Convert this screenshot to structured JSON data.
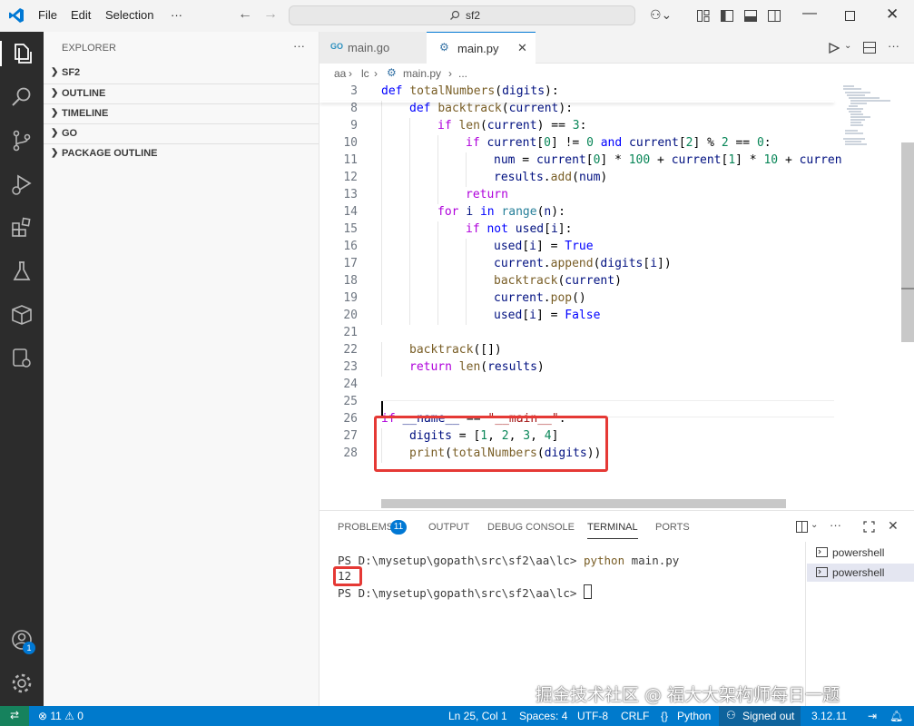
{
  "titlebar": {
    "menus": [
      "File",
      "Edit",
      "Selection",
      "···"
    ],
    "search_text": "sf2"
  },
  "sidebar": {
    "title": "EXPLORER",
    "sections": [
      "SF2",
      "OUTLINE",
      "TIMELINE",
      "GO",
      "PACKAGE OUTLINE"
    ],
    "more": "···"
  },
  "tabs": [
    {
      "label": "main.go",
      "icon_text": "GO"
    },
    {
      "label": "main.py",
      "icon_text": "⚙"
    }
  ],
  "breadcrumbs": [
    "aa",
    "lc",
    "main.py",
    "..."
  ],
  "editor": {
    "lines": [
      {
        "n": "3",
        "i": 0,
        "t": [
          [
            "kw",
            "def "
          ],
          [
            "fn",
            "totalNumbers"
          ],
          [
            "op",
            "("
          ],
          [
            "var",
            "digits"
          ],
          [
            "op",
            "):"
          ]
        ]
      },
      {
        "n": "8",
        "i": 1,
        "t": [
          [
            "kw",
            "def "
          ],
          [
            "fn",
            "backtrack"
          ],
          [
            "op",
            "("
          ],
          [
            "var",
            "current"
          ],
          [
            "op",
            "):"
          ]
        ]
      },
      {
        "n": "9",
        "i": 2,
        "t": [
          [
            "kc",
            "if "
          ],
          [
            "fn",
            "len"
          ],
          [
            "op",
            "("
          ],
          [
            "var",
            "current"
          ],
          [
            "op",
            ") == "
          ],
          [
            "num",
            "3"
          ],
          [
            "op",
            ":"
          ]
        ]
      },
      {
        "n": "10",
        "i": 3,
        "t": [
          [
            "kc",
            "if "
          ],
          [
            "var",
            "current"
          ],
          [
            "op",
            "["
          ],
          [
            "num",
            "0"
          ],
          [
            "op",
            "] != "
          ],
          [
            "num",
            "0"
          ],
          [
            "kw",
            " and "
          ],
          [
            "var",
            "current"
          ],
          [
            "op",
            "["
          ],
          [
            "num",
            "2"
          ],
          [
            "op",
            "] % "
          ],
          [
            "num",
            "2"
          ],
          [
            "op",
            " == "
          ],
          [
            "num",
            "0"
          ],
          [
            "op",
            ":"
          ]
        ]
      },
      {
        "n": "11",
        "i": 4,
        "t": [
          [
            "var",
            "num"
          ],
          [
            "op",
            " = "
          ],
          [
            "var",
            "current"
          ],
          [
            "op",
            "["
          ],
          [
            "num",
            "0"
          ],
          [
            "op",
            "] * "
          ],
          [
            "num",
            "100"
          ],
          [
            "op",
            " + "
          ],
          [
            "var",
            "current"
          ],
          [
            "op",
            "["
          ],
          [
            "num",
            "1"
          ],
          [
            "op",
            "] * "
          ],
          [
            "num",
            "10"
          ],
          [
            "op",
            " + "
          ],
          [
            "var",
            "curren"
          ]
        ]
      },
      {
        "n": "12",
        "i": 4,
        "t": [
          [
            "var",
            "results"
          ],
          [
            "op",
            "."
          ],
          [
            "fn",
            "add"
          ],
          [
            "op",
            "("
          ],
          [
            "var",
            "num"
          ],
          [
            "op",
            ")"
          ]
        ]
      },
      {
        "n": "13",
        "i": 3,
        "t": [
          [
            "kc",
            "return"
          ]
        ]
      },
      {
        "n": "14",
        "i": 2,
        "t": [
          [
            "kc",
            "for "
          ],
          [
            "var",
            "i"
          ],
          [
            "kw",
            " in "
          ],
          [
            "bi",
            "range"
          ],
          [
            "op",
            "("
          ],
          [
            "var",
            "n"
          ],
          [
            "op",
            "):"
          ]
        ]
      },
      {
        "n": "15",
        "i": 3,
        "t": [
          [
            "kc",
            "if "
          ],
          [
            "kw",
            "not "
          ],
          [
            "var",
            "used"
          ],
          [
            "op",
            "["
          ],
          [
            "var",
            "i"
          ],
          [
            "op",
            "]:"
          ]
        ]
      },
      {
        "n": "16",
        "i": 4,
        "t": [
          [
            "var",
            "used"
          ],
          [
            "op",
            "["
          ],
          [
            "var",
            "i"
          ],
          [
            "op",
            "] = "
          ],
          [
            "kw",
            "True"
          ]
        ]
      },
      {
        "n": "17",
        "i": 4,
        "t": [
          [
            "var",
            "current"
          ],
          [
            "op",
            "."
          ],
          [
            "fn",
            "append"
          ],
          [
            "op",
            "("
          ],
          [
            "var",
            "digits"
          ],
          [
            "op",
            "["
          ],
          [
            "var",
            "i"
          ],
          [
            "op",
            "])"
          ]
        ]
      },
      {
        "n": "18",
        "i": 4,
        "t": [
          [
            "fn",
            "backtrack"
          ],
          [
            "op",
            "("
          ],
          [
            "var",
            "current"
          ],
          [
            "op",
            ")"
          ]
        ]
      },
      {
        "n": "19",
        "i": 4,
        "t": [
          [
            "var",
            "current"
          ],
          [
            "op",
            "."
          ],
          [
            "fn",
            "pop"
          ],
          [
            "op",
            "()"
          ]
        ]
      },
      {
        "n": "20",
        "i": 4,
        "t": [
          [
            "var",
            "used"
          ],
          [
            "op",
            "["
          ],
          [
            "var",
            "i"
          ],
          [
            "op",
            "] = "
          ],
          [
            "kw",
            "False"
          ]
        ]
      },
      {
        "n": "21",
        "i": 0,
        "t": []
      },
      {
        "n": "22",
        "i": 1,
        "t": [
          [
            "fn",
            "backtrack"
          ],
          [
            "op",
            "([])"
          ]
        ]
      },
      {
        "n": "23",
        "i": 1,
        "t": [
          [
            "kc",
            "return "
          ],
          [
            "fn",
            "len"
          ],
          [
            "op",
            "("
          ],
          [
            "var",
            "results"
          ],
          [
            "op",
            ")"
          ]
        ]
      },
      {
        "n": "24",
        "i": 0,
        "t": []
      },
      {
        "n": "25",
        "i": 0,
        "t": []
      },
      {
        "n": "26",
        "i": 0,
        "t": [
          [
            "kc",
            "if "
          ],
          [
            "var",
            "__name__"
          ],
          [
            "op",
            " == "
          ],
          [
            "str",
            "\"__main__\""
          ],
          [
            "op",
            ":"
          ]
        ]
      },
      {
        "n": "27",
        "i": 1,
        "t": [
          [
            "var",
            "digits"
          ],
          [
            "op",
            " = ["
          ],
          [
            "num",
            "1"
          ],
          [
            "op",
            ", "
          ],
          [
            "num",
            "2"
          ],
          [
            "op",
            ", "
          ],
          [
            "num",
            "3"
          ],
          [
            "op",
            ", "
          ],
          [
            "num",
            "4"
          ],
          [
            "op",
            "]"
          ]
        ]
      },
      {
        "n": "28",
        "i": 1,
        "t": [
          [
            "fn",
            "print"
          ],
          [
            "op",
            "("
          ],
          [
            "fn",
            "totalNumbers"
          ],
          [
            "op",
            "("
          ],
          [
            "var",
            "digits"
          ],
          [
            "op",
            "))"
          ]
        ]
      }
    ]
  },
  "panel": {
    "tabs": [
      "PROBLEMS",
      "OUTPUT",
      "DEBUG CONSOLE",
      "TERMINAL",
      "PORTS"
    ],
    "problems_count": "11",
    "terminal_lines": [
      {
        "prompt": "PS D:\\mysetup\\gopath\\src\\sf2\\aa\\lc> ",
        "cmd_a": "python",
        "cmd_b": " main.py"
      },
      {
        "output": "12"
      },
      {
        "prompt": "PS D:\\mysetup\\gopath\\src\\sf2\\aa\\lc> "
      }
    ],
    "terminals": [
      "powershell",
      "powershell"
    ]
  },
  "statusbar": {
    "problems": "⊗ 11 ⚠ 0",
    "position": "Ln 25, Col 1",
    "spaces": "Spaces: 4",
    "encoding": "UTF-8",
    "eol": "CRLF",
    "language": "Python",
    "account": "Signed out",
    "version": "3.12.11",
    "account_badge": "1"
  },
  "watermark": "掘金技术社区 @ 福大大架构师每日一题",
  "colors": {
    "accent": "#007acc",
    "highlight_box": "#e53935"
  }
}
